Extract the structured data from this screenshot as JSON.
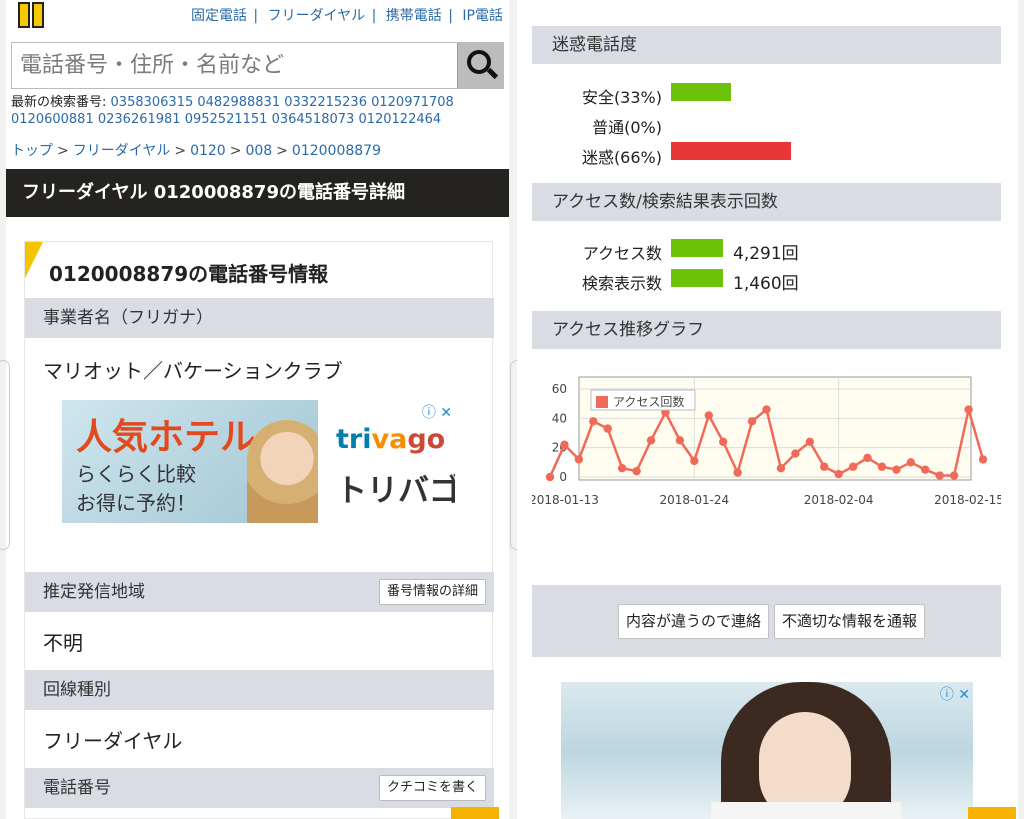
{
  "header": {
    "links": [
      "固定電話",
      "フリーダイヤル",
      "携帯電話",
      "IP電話"
    ],
    "separator": "|"
  },
  "search": {
    "placeholder": "電話番号・住所・名前など"
  },
  "recent": {
    "label": "最新の検索番号:",
    "numbers": [
      "0358306315",
      "0482988831",
      "0332215236",
      "0120971708",
      "0120600881",
      "0236261981",
      "0952521151",
      "0364518073",
      "0120122464"
    ]
  },
  "breadcrumb": {
    "items": [
      "トップ",
      "フリーダイヤル",
      "0120",
      "008",
      "0120008879"
    ],
    "separator": ">"
  },
  "page_heading": "フリーダイヤル 0120008879の電話番号詳細",
  "info_card": {
    "title": "0120008879の電話番号情報",
    "business_label": "事業者名（フリガナ）",
    "business_value": "マリオット／バケーションクラブ",
    "region_label": "推定発信地域",
    "region_button": "番号情報の詳細",
    "region_value": "不明",
    "line_label": "回線種別",
    "line_value": "フリーダイヤル",
    "phone_label": "電話番号",
    "review_button": "クチコミを書く"
  },
  "ad_hotel": {
    "headline": "人気ホテル",
    "line1": "らくらく比較",
    "line2": "お得に予約！",
    "brand_latin": [
      "tri",
      "va",
      "go"
    ],
    "brand_kana": "トリバゴ",
    "info_icon": "ⓘ",
    "close_icon": "✕"
  },
  "nuisance": {
    "title": "迷惑電話度",
    "rows": [
      {
        "label": "安全(33%)",
        "value": 33,
        "color": "#6cc30a"
      },
      {
        "label": "普通(0%)",
        "value": 0,
        "color": "#6cc30a"
      },
      {
        "label": "迷惑(66%)",
        "value": 66,
        "color": "#e83535"
      }
    ]
  },
  "access": {
    "title": "アクセス数/検索結果表示回数",
    "rows": [
      {
        "label": "アクセス数",
        "value": "4,291回",
        "color": "#6cc30a"
      },
      {
        "label": "検索表示数",
        "value": "1,460回",
        "color": "#6cc30a"
      }
    ]
  },
  "chart_section_title": "アクセス推移グラフ",
  "chart_data": {
    "type": "line",
    "title": "",
    "series": [
      {
        "name": "アクセス回数",
        "color": "#f06a5a",
        "values": [
          0,
          22,
          12,
          38,
          33,
          6,
          4,
          25,
          44,
          25,
          11,
          42,
          24,
          3,
          38,
          46,
          6,
          16,
          24,
          7,
          2,
          7,
          13,
          7,
          5,
          10,
          5,
          1,
          1,
          46,
          12
        ]
      }
    ],
    "x_start": "2018-01-13",
    "x_end": "2018-02-15",
    "xtick_labels": [
      "2018-01-13",
      "2018-01-24",
      "2018-02-04",
      "2018-02-15"
    ],
    "ylim": [
      0,
      60
    ],
    "yticks": [
      0,
      20,
      40,
      60
    ],
    "legend_position": "top-left",
    "grid": true
  },
  "footer_buttons": {
    "report_wrong": "内容が違うので連絡",
    "report_bad": "不適切な情報を通報"
  },
  "ad_bottom": {
    "info_icon": "ⓘ",
    "close_icon": "✕"
  }
}
